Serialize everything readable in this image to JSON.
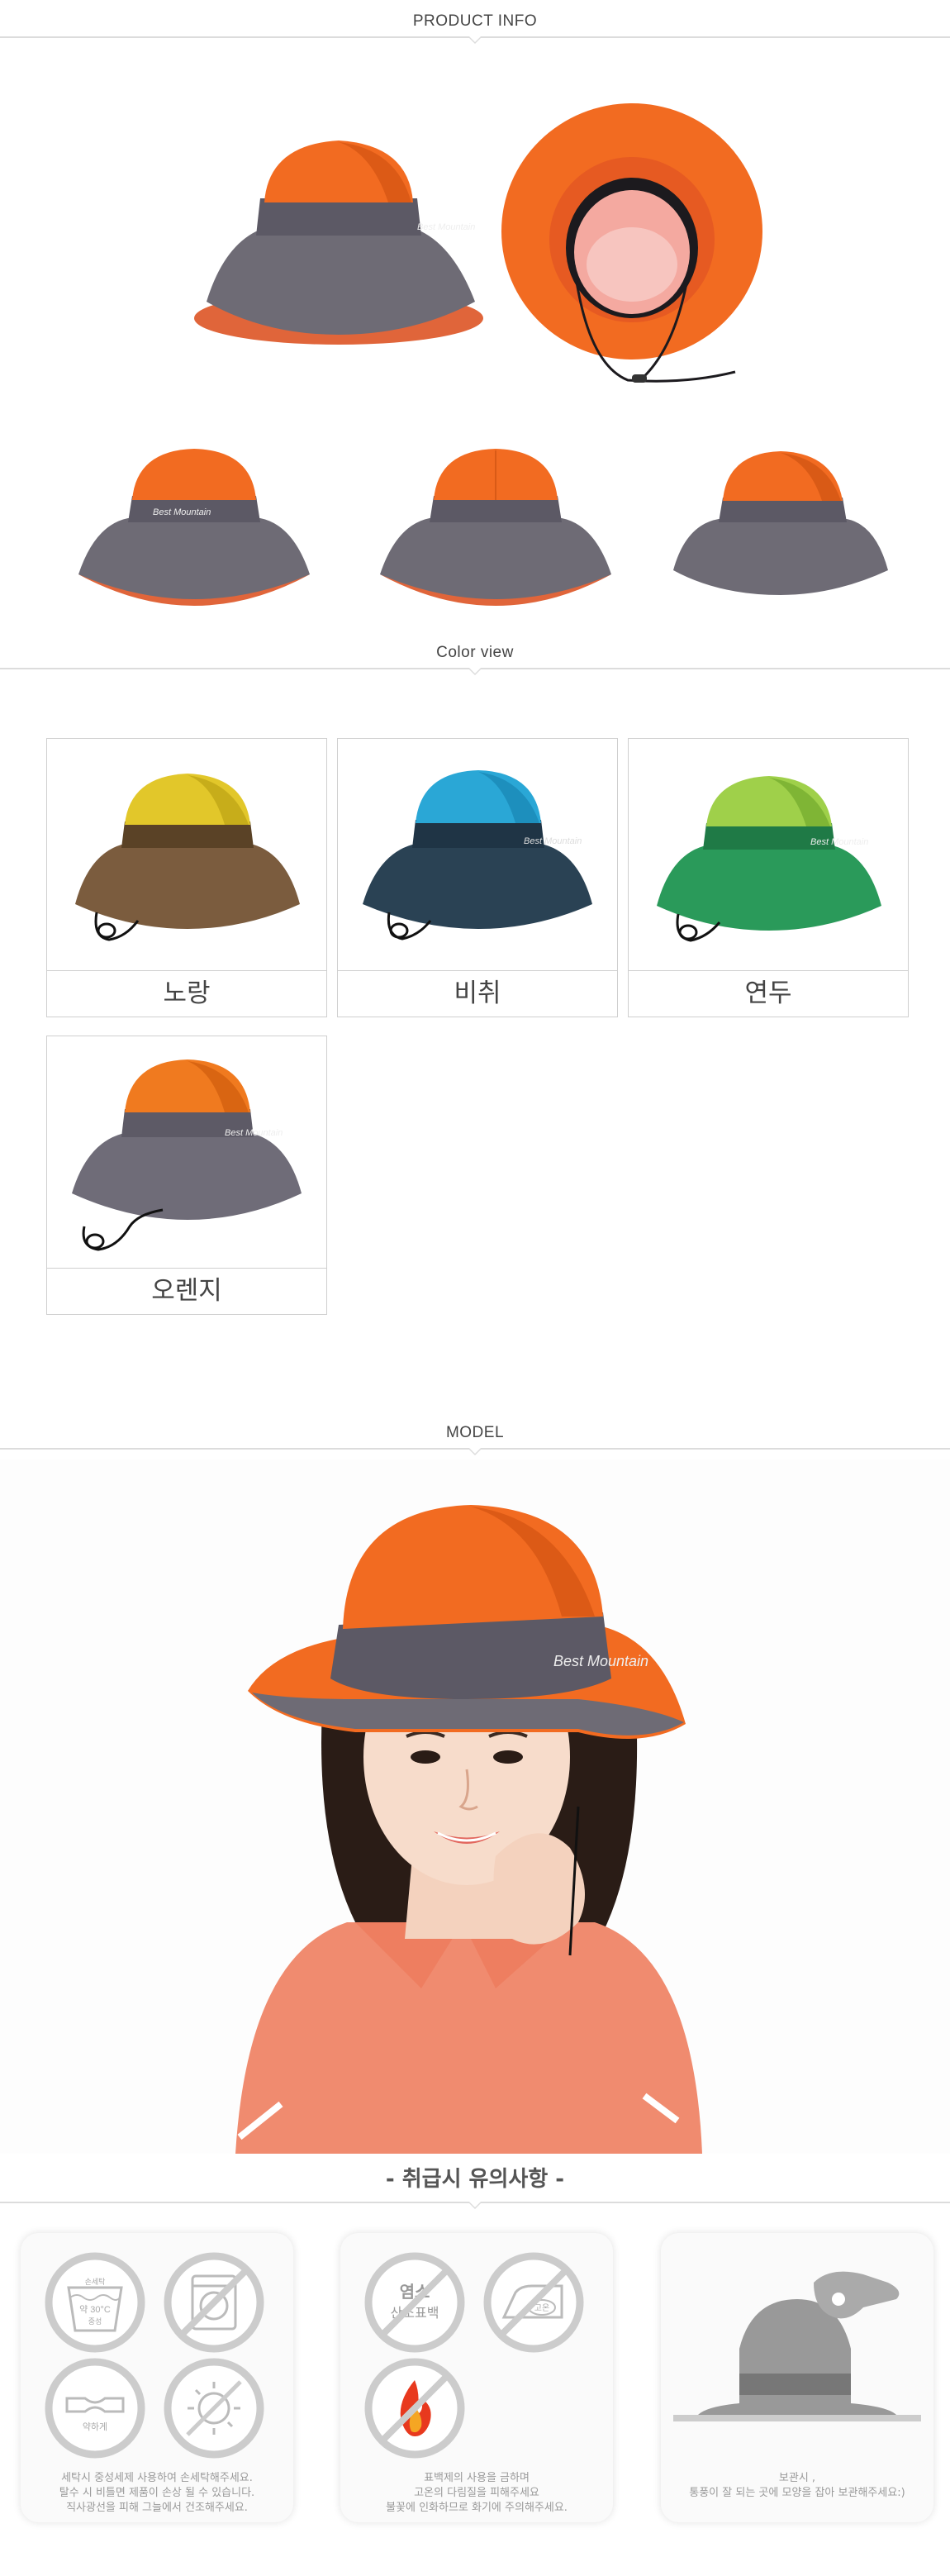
{
  "sections": {
    "product_info": "PRODUCT INFO",
    "color_view": "Color view",
    "model": "MODEL"
  },
  "brand_text": "Best Mountain",
  "colors": [
    {
      "name": "노랑",
      "crown": "#e2c72a",
      "crown_shade": "#c7ad1a",
      "band": "#5a4226",
      "brim": "#7b5c3e"
    },
    {
      "name": "비취",
      "crown": "#2aa7d6",
      "crown_shade": "#1d8fbd",
      "band": "#1f3445",
      "brim": "#2a4254"
    },
    {
      "name": "연두",
      "crown": "#9fd04a",
      "crown_shade": "#7fb535",
      "band": "#1f7a46",
      "brim": "#2a9a5a"
    },
    {
      "name": "오렌지",
      "crown": "#f07a1f",
      "crown_shade": "#d96512",
      "band": "#5d5a66",
      "brim": "#6f6c78"
    }
  ],
  "palette": {
    "orange": "#f26b21",
    "gray": "#6e6b75",
    "border": "#cfcfcf"
  },
  "care": {
    "title": "- 취급시 유의사항 -",
    "boxes": [
      {
        "icons": [
          {
            "name": "hand-wash-icon",
            "label_top": "손세탁",
            "label_mid": "약 30°C",
            "label_bot": "중성"
          },
          {
            "name": "no-machine-wash-icon",
            "label_top": "",
            "label_mid": "",
            "label_bot": ""
          },
          {
            "name": "gentle-wring-icon",
            "label_top": "",
            "label_mid": "약하게",
            "label_bot": ""
          },
          {
            "name": "no-sun-dry-icon",
            "label_top": "",
            "label_mid": "",
            "label_bot": ""
          }
        ],
        "text": [
          "세탁시 중성세제 사용하여 손세탁해주세요.",
          "탈수 시 비틀면 제품이 손상 될 수 있습니다.",
          "직사광선을 피해 그늘에서 건조해주세요."
        ]
      },
      {
        "icons": [
          {
            "name": "no-bleach-icon",
            "label_top": "염소",
            "label_mid": "산소표백",
            "label_bot": ""
          },
          {
            "name": "high-temp-iron-icon",
            "label_top": "",
            "label_mid": "고온",
            "label_bot": ""
          },
          {
            "name": "no-fire-icon",
            "label_top": "",
            "label_mid": "",
            "label_bot": ""
          }
        ],
        "text": [
          "표백제의 사용을 금하며",
          "고온의 다림질을 피해주세요",
          "불꽃에 인화하므로 화기에 주의해주세요."
        ]
      },
      {
        "icons": [
          {
            "name": "hang-store-icon",
            "label_top": "",
            "label_mid": "",
            "label_bot": ""
          }
        ],
        "text": [
          "보관시 ,",
          "통풍이 잘 되는 곳에 모양을 잡아 보관해주세요:)"
        ]
      }
    ]
  }
}
